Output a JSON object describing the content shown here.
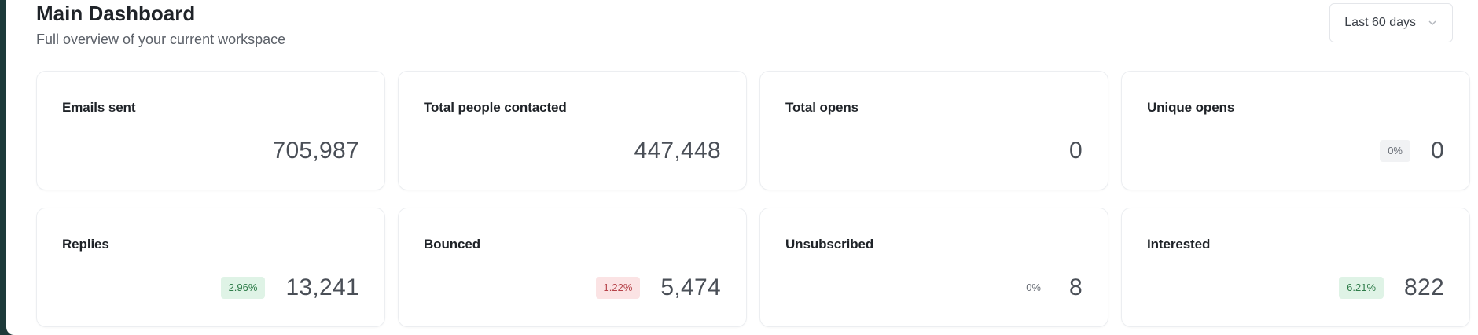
{
  "header": {
    "title": "Main Dashboard",
    "subtitle": "Full overview of your current workspace",
    "range_select": {
      "selected": "Last 60 days",
      "icon": "chevron-down-icon"
    }
  },
  "cards": [
    {
      "key": "emails-sent",
      "label": "Emails sent",
      "value": "705,987",
      "badge": null
    },
    {
      "key": "total-people-contacted",
      "label": "Total people contacted",
      "value": "447,448",
      "badge": null
    },
    {
      "key": "total-opens",
      "label": "Total opens",
      "value": "0",
      "badge": null
    },
    {
      "key": "unique-opens",
      "label": "Unique opens",
      "value": "0",
      "badge": {
        "text": "0%",
        "tone": "gray"
      }
    },
    {
      "key": "replies",
      "label": "Replies",
      "value": "13,241",
      "badge": {
        "text": "2.96%",
        "tone": "green"
      }
    },
    {
      "key": "bounced",
      "label": "Bounced",
      "value": "5,474",
      "badge": {
        "text": "1.22%",
        "tone": "red"
      }
    },
    {
      "key": "unsubscribed",
      "label": "Unsubscribed",
      "value": "8",
      "badge": {
        "text": "0%",
        "tone": "plain"
      }
    },
    {
      "key": "interested",
      "label": "Interested",
      "value": "822",
      "badge": {
        "text": "6.21%",
        "tone": "green"
      }
    }
  ],
  "colors": {
    "badge_green_bg": "#dff3e6",
    "badge_red_bg": "#fbe3e4",
    "backdrop": "#1d3a3a"
  }
}
